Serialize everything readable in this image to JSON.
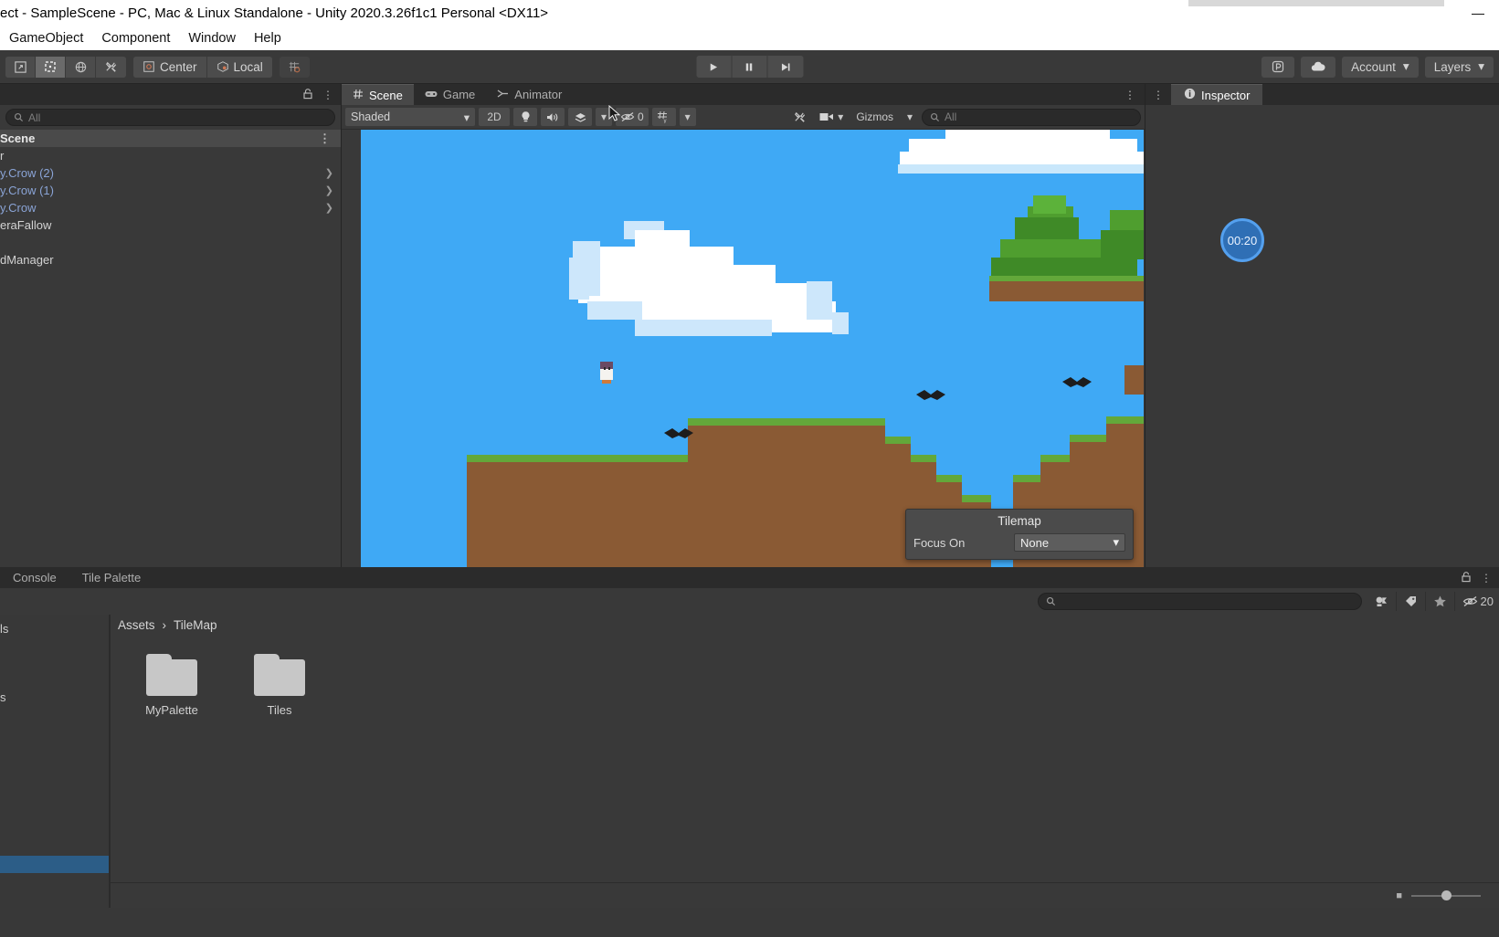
{
  "window": {
    "title": "ect - SampleScene - PC, Mac & Linux Standalone - Unity 2020.3.26f1c1 Personal <DX11>",
    "controls": {
      "minimize": "—",
      "maximize": "☐",
      "close": "✕"
    }
  },
  "menubar": {
    "items": [
      {
        "label": "GameObject"
      },
      {
        "label": "Component"
      },
      {
        "label": "Window"
      },
      {
        "label": "Help"
      }
    ]
  },
  "toolbar": {
    "tools": [
      {
        "name": "hand-tool",
        "icon": "move-view"
      },
      {
        "name": "rect-tool",
        "icon": "rect-transform",
        "active": true
      },
      {
        "name": "rotate-tool",
        "icon": "rotate"
      },
      {
        "name": "custom-tool",
        "icon": "wrench"
      }
    ],
    "pivot_label": "Center",
    "space_label": "Local",
    "grid_label": "grid-snapping",
    "play": "▶",
    "pause": "❙❙",
    "step": "▶|",
    "collab_label": "collab",
    "cloud_label": "cloud",
    "account_label": "Account",
    "layers_label": "Layers"
  },
  "hierarchy": {
    "search_placeholder": "All",
    "scene_row": "Scene",
    "items": [
      {
        "label": "r",
        "prefab": false,
        "expandable": false
      },
      {
        "label": "y.Crow (2)",
        "prefab": true,
        "expandable": true
      },
      {
        "label": "y.Crow (1)",
        "prefab": true,
        "expandable": true
      },
      {
        "label": "y.Crow",
        "prefab": true,
        "expandable": true
      },
      {
        "label": "eraFallow",
        "prefab": false,
        "expandable": false
      },
      {
        "label": "",
        "prefab": false,
        "expandable": false
      },
      {
        "label": "dManager",
        "prefab": false,
        "expandable": false
      }
    ]
  },
  "sceneview": {
    "tabs": [
      {
        "label": "Scene",
        "icon": "grid-icon",
        "active": true
      },
      {
        "label": "Game",
        "icon": "gamepad-icon",
        "active": false
      },
      {
        "label": "Animator",
        "icon": "animator-icon",
        "active": false
      }
    ],
    "draw_mode": "Shaded",
    "mode_2d": "2D",
    "lighting_icon": "lightbulb-icon",
    "audio_icon": "speaker-icon",
    "effects_icon": "effects-icon",
    "hidden_count": "0",
    "grid_icon": "grid-axis-icon",
    "tools_icon": "wrench-icon",
    "camera_icon": "camera-icon",
    "gizmos_label": "Gizmos",
    "search_placeholder": "All",
    "overlay": {
      "title": "Tilemap",
      "focus_label": "Focus On",
      "focus_value": "None"
    }
  },
  "inspector": {
    "tab_label": "Inspector",
    "timer_badge": "00:20"
  },
  "bottom": {
    "tabs": [
      {
        "label": "Console",
        "active": false
      },
      {
        "label": "Tile Palette",
        "active": false
      }
    ],
    "search_placeholder": "",
    "filters": [
      {
        "name": "type-filter-icon"
      },
      {
        "name": "label-filter-icon"
      },
      {
        "name": "favorites-icon"
      }
    ],
    "hidden_count": "20",
    "tree_items": [
      {
        "label": "ls"
      },
      {
        "label": ""
      },
      {
        "label": "s"
      }
    ],
    "breadcrumb": [
      {
        "label": "Assets"
      },
      {
        "label": "TileMap"
      }
    ],
    "breadcrumb_sep": "›",
    "assets": [
      {
        "label": "MyPalette",
        "type": "folder"
      },
      {
        "label": "Tiles",
        "type": "folder"
      }
    ]
  },
  "colors": {
    "accent_blue": "#3fa9f5",
    "panel_bg": "#383838",
    "tab_bg": "#2b2b2b",
    "selection": "#2c5d87",
    "prefab_text": "#8aa4d6"
  }
}
